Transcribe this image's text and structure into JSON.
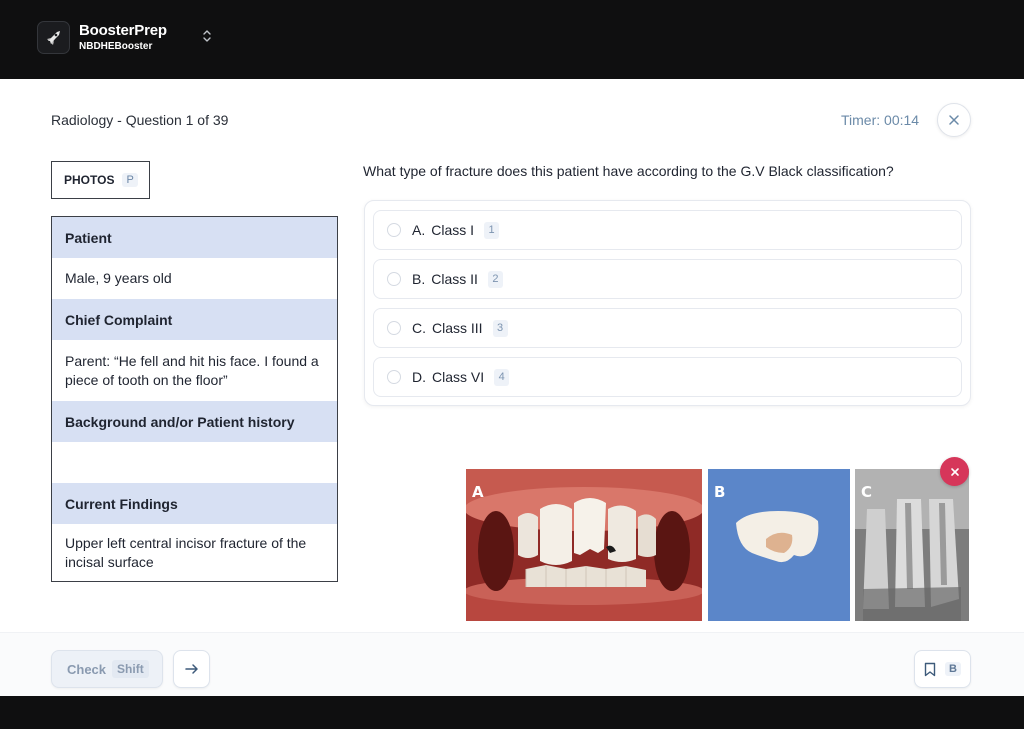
{
  "app": {
    "brand_name": "BoosterPrep",
    "brand_sub": "NBDHEBooster"
  },
  "header": {
    "question_title": "Radiology - Question 1 of 39",
    "timer": "Timer: 00:14"
  },
  "photos_button": {
    "label": "PHOTOS",
    "shortcut": "P"
  },
  "patient_panel": {
    "sections": [
      {
        "heading": "Patient",
        "body": "Male, 9 years old"
      },
      {
        "heading": "Chief Complaint",
        "body": "Parent: “He fell and hit his face. I found a piece of tooth on the floor”"
      },
      {
        "heading": "Background and/or Patient history",
        "body": ""
      },
      {
        "heading": "Current Findings",
        "body": "Upper left central incisor fracture of the incisal surface"
      }
    ]
  },
  "question": {
    "text": "What type of fracture does this patient have according to the G.V Black classification?",
    "options": [
      {
        "letter": "A.",
        "text": "Class I",
        "shortcut": "1"
      },
      {
        "letter": "B.",
        "text": "Class II",
        "shortcut": "2"
      },
      {
        "letter": "C.",
        "text": "Class III",
        "shortcut": "3"
      },
      {
        "letter": "D.",
        "text": "Class VI",
        "shortcut": "4"
      }
    ]
  },
  "photos": {
    "labels": [
      "A",
      "B",
      "C"
    ]
  },
  "footer": {
    "check_label": "Check",
    "check_shortcut": "Shift",
    "bookmark_shortcut": "B"
  },
  "colors": {
    "section_header_bg": "#d7e0f3",
    "timer": "#6b8aa8",
    "photo_close": "#d6365a"
  }
}
